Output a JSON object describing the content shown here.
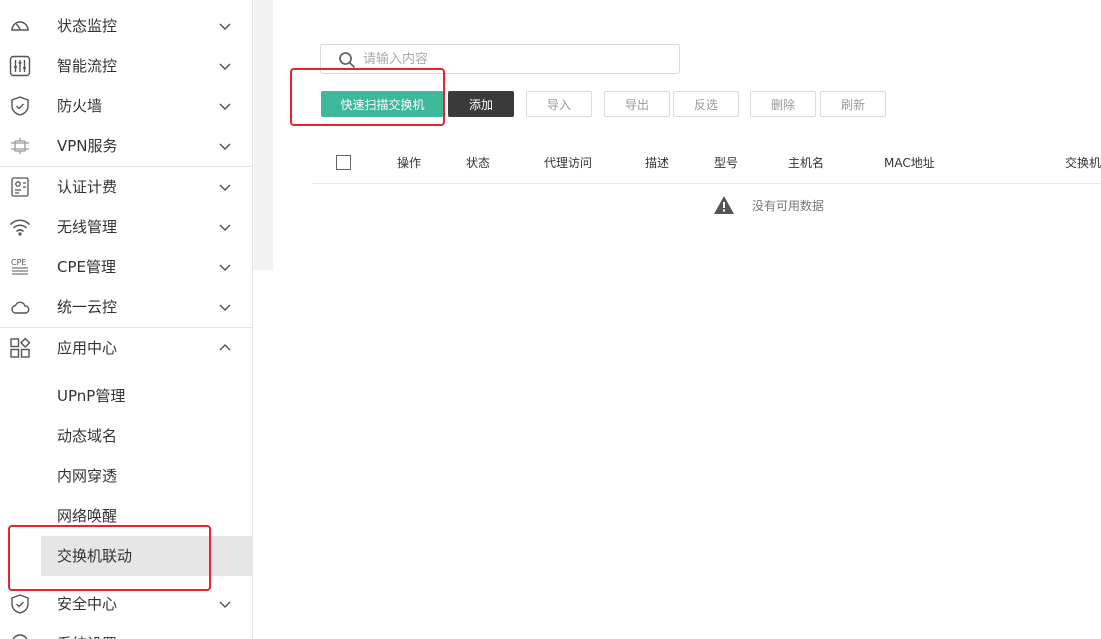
{
  "sidebar": {
    "items": [
      {
        "label": "状态监控",
        "icon": "speedometer-icon"
      },
      {
        "label": "智能流控",
        "icon": "sliders-icon"
      },
      {
        "label": "防火墙",
        "icon": "shield-icon"
      },
      {
        "label": "VPN服务",
        "icon": "vpn-icon"
      },
      {
        "label": "认证计费",
        "icon": "auth-billing-icon"
      },
      {
        "label": "无线管理",
        "icon": "wifi-icon"
      },
      {
        "label": "CPE管理",
        "icon": "cpe-icon"
      },
      {
        "label": "统一云控",
        "icon": "cloud-icon"
      },
      {
        "label": "应用中心",
        "icon": "apps-icon",
        "expanded": true
      },
      {
        "label": "安全中心",
        "icon": "shield-check-icon"
      }
    ],
    "sub_items": [
      {
        "label": "UPnP管理"
      },
      {
        "label": "动态域名"
      },
      {
        "label": "内网穿透"
      },
      {
        "label": "网络唤醒"
      },
      {
        "label": "交换机联动",
        "active": true
      }
    ],
    "last_item_partial": "系统设置"
  },
  "search": {
    "placeholder": "请输入内容",
    "value": ""
  },
  "toolbar": {
    "scan_label": "快速扫描交换机",
    "add_label": "添加",
    "import_label": "导入",
    "export_label": "导出",
    "invert_label": "反选",
    "delete_label": "删除",
    "refresh_label": "刷新"
  },
  "table": {
    "headers": [
      "操作",
      "状态",
      "代理访问",
      "描述",
      "型号",
      "主机名",
      "MAC地址",
      "交换机"
    ],
    "empty_text": "没有可用数据"
  },
  "colors": {
    "accent_green": "#3cb89a",
    "dark_button": "#3a3a3a",
    "highlight_red": "#e8232c",
    "active_bg": "#e6e6e6"
  }
}
